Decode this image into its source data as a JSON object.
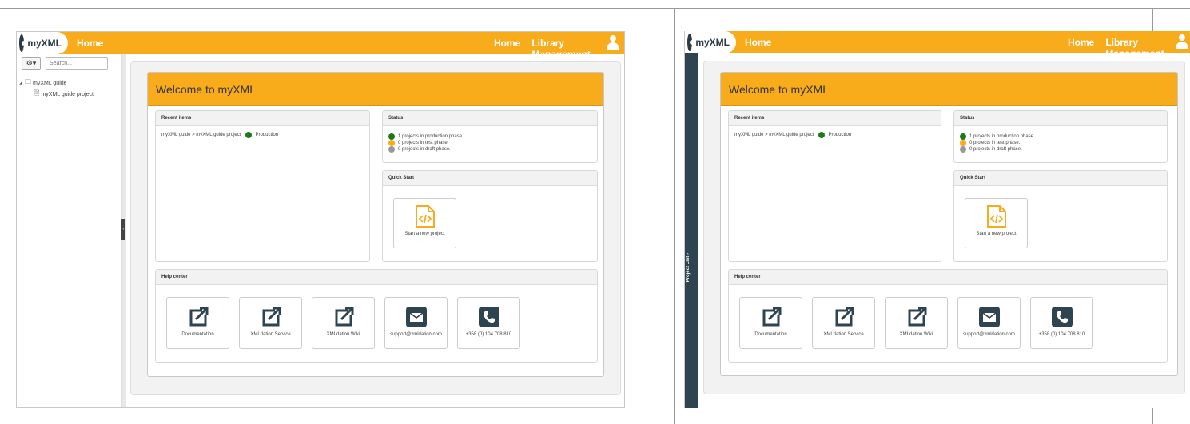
{
  "app": {
    "logo_text": "myXML",
    "page_title": "Home",
    "nav": [
      "Home",
      "Library Management"
    ]
  },
  "sidebar": {
    "search_placeholder": "Search...",
    "gear_label": "⚙▾",
    "tree": {
      "folder": "myXML guide",
      "project": "myXML guide project"
    },
    "rail_label": "Project List"
  },
  "welcome": {
    "title": "Welcome to myXML"
  },
  "recent": {
    "title": "Recent items",
    "item_path": "myXML guide > myXML guide project",
    "item_status": "Production"
  },
  "status": {
    "title": "Status",
    "rows": [
      {
        "text": "1 projects in production phase.",
        "color": "#1a7a1a"
      },
      {
        "text": "0 projects in test phase.",
        "color": "#f8ab1b"
      },
      {
        "text": "0 projects in draft phase.",
        "color": "#999999"
      }
    ]
  },
  "quickstart": {
    "title": "Quick Start",
    "tile_label": "Start a new project"
  },
  "help": {
    "title": "Help center",
    "tiles": [
      {
        "label": "Documentation",
        "icon": "external-link-icon"
      },
      {
        "label": "XMLdation Service",
        "icon": "external-link-icon"
      },
      {
        "label": "XMLdation Wiki",
        "icon": "external-link-icon"
      },
      {
        "label": "support@xmldation.com",
        "icon": "envelope-icon"
      },
      {
        "label": "+358 (0) 104 708 810",
        "icon": "phone-icon"
      }
    ]
  },
  "colors": {
    "brand": "#f8ab1b",
    "dark": "#2e4450",
    "production": "#1a7a1a"
  }
}
